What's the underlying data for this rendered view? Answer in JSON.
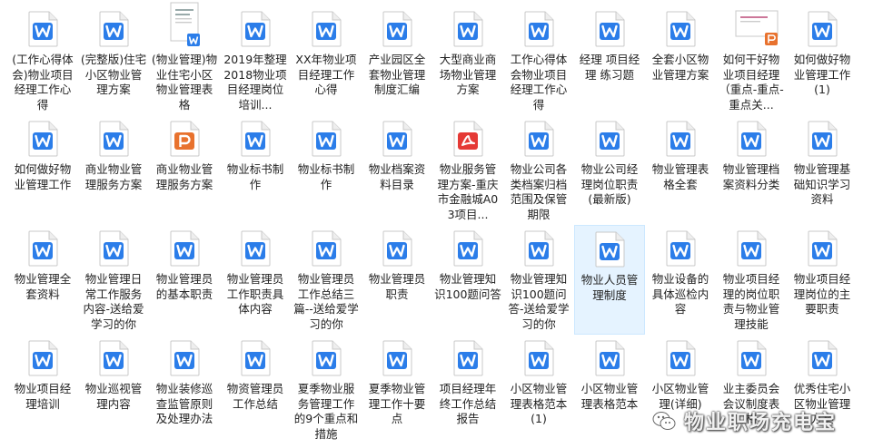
{
  "files": [
    {
      "name": "(工作心得体会)物业项目经理工作心得",
      "type": "word"
    },
    {
      "name": "(完整版)住宅小区物业管理方案",
      "type": "word"
    },
    {
      "name": "(物业管理)物业住宅小区物业管理表格",
      "type": "word-thumb"
    },
    {
      "name": "2019年整理2018物业项目经理岗位培训...",
      "type": "word"
    },
    {
      "name": "XX年物业项目经理工作心得",
      "type": "word"
    },
    {
      "name": "产业园区全套物业管理制度汇编",
      "type": "word"
    },
    {
      "name": "大型商业商场物业管理方案",
      "type": "word"
    },
    {
      "name": "工作心得体会物业项目经理工作心得",
      "type": "word"
    },
    {
      "name": "经理 项目经理 练习题",
      "type": "word"
    },
    {
      "name": "全套小区物业管理方案",
      "type": "word"
    },
    {
      "name": "如何干好物业项目经理（重点-重点-重点关...",
      "type": "ppt-thumb"
    },
    {
      "name": "如何做好物业管理工作(1)",
      "type": "word"
    },
    {
      "name": "如何做好物业管理工作",
      "type": "word"
    },
    {
      "name": "商业物业管理服务方案",
      "type": "word"
    },
    {
      "name": "商业物业管理服务方案",
      "type": "ppt"
    },
    {
      "name": "物业标书制作",
      "type": "word"
    },
    {
      "name": "物业标书制作",
      "type": "word"
    },
    {
      "name": "物业档案资料目录",
      "type": "word"
    },
    {
      "name": "物业服务管理方案-重庆市金融城A03项目...",
      "type": "pdf"
    },
    {
      "name": "物业公司各类档案归档范围及保管期限",
      "type": "word"
    },
    {
      "name": "物业公司经理岗位职责(最新版)",
      "type": "word"
    },
    {
      "name": "物业管理表格全套",
      "type": "word"
    },
    {
      "name": "物业管理档案资料分类",
      "type": "word"
    },
    {
      "name": "物业管理基础知识学习资料",
      "type": "word"
    },
    {
      "name": "物业管理全套资料",
      "type": "word"
    },
    {
      "name": "物业管理日常工作服务内容-送给爱学习的你",
      "type": "word"
    },
    {
      "name": "物业管理员的基本职责",
      "type": "word"
    },
    {
      "name": "物业管理员工作职责具体内容",
      "type": "word"
    },
    {
      "name": "物业管理员工作总结三篇--送给爱学习的你",
      "type": "word"
    },
    {
      "name": "物业管理员职责",
      "type": "word"
    },
    {
      "name": "物业管理知识100题问答",
      "type": "word"
    },
    {
      "name": "物业管理知识100题问答-送给爱学习的你",
      "type": "word"
    },
    {
      "name": "物业人员管理制度",
      "type": "word",
      "selected": true
    },
    {
      "name": "物业设备的具体巡检内容",
      "type": "word"
    },
    {
      "name": "物业项目经理的岗位职责与物业管理技能",
      "type": "word"
    },
    {
      "name": "物业项目经理岗位的主要职责",
      "type": "word"
    },
    {
      "name": "物业项目经理培训",
      "type": "word"
    },
    {
      "name": "物业巡视管理内容",
      "type": "word"
    },
    {
      "name": "物业装修巡查监管原则及处理办法",
      "type": "word"
    },
    {
      "name": "物资管理员工作总结",
      "type": "word"
    },
    {
      "name": "夏季物业服务管理工作的9个重点和措施",
      "type": "word"
    },
    {
      "name": "夏季物业管理工作十要点",
      "type": "word"
    },
    {
      "name": "项目经理年终工作总结报告",
      "type": "word"
    },
    {
      "name": "小区物业管理表格范本(1)",
      "type": "word"
    },
    {
      "name": "小区物业管理表格范本",
      "type": "word"
    },
    {
      "name": "小区物业管理(详细)",
      "type": "word"
    },
    {
      "name": "业主委员会会议制度表格",
      "type": "word"
    },
    {
      "name": "优秀住宅小区物业管理方案",
      "type": "word"
    }
  ],
  "watermark": {
    "text": "物业职场充电宝"
  },
  "colors": {
    "word": "#2b7de9",
    "ppt": "#e8722e",
    "pdf": "#e53935",
    "selected_bg": "#e5f3ff"
  }
}
